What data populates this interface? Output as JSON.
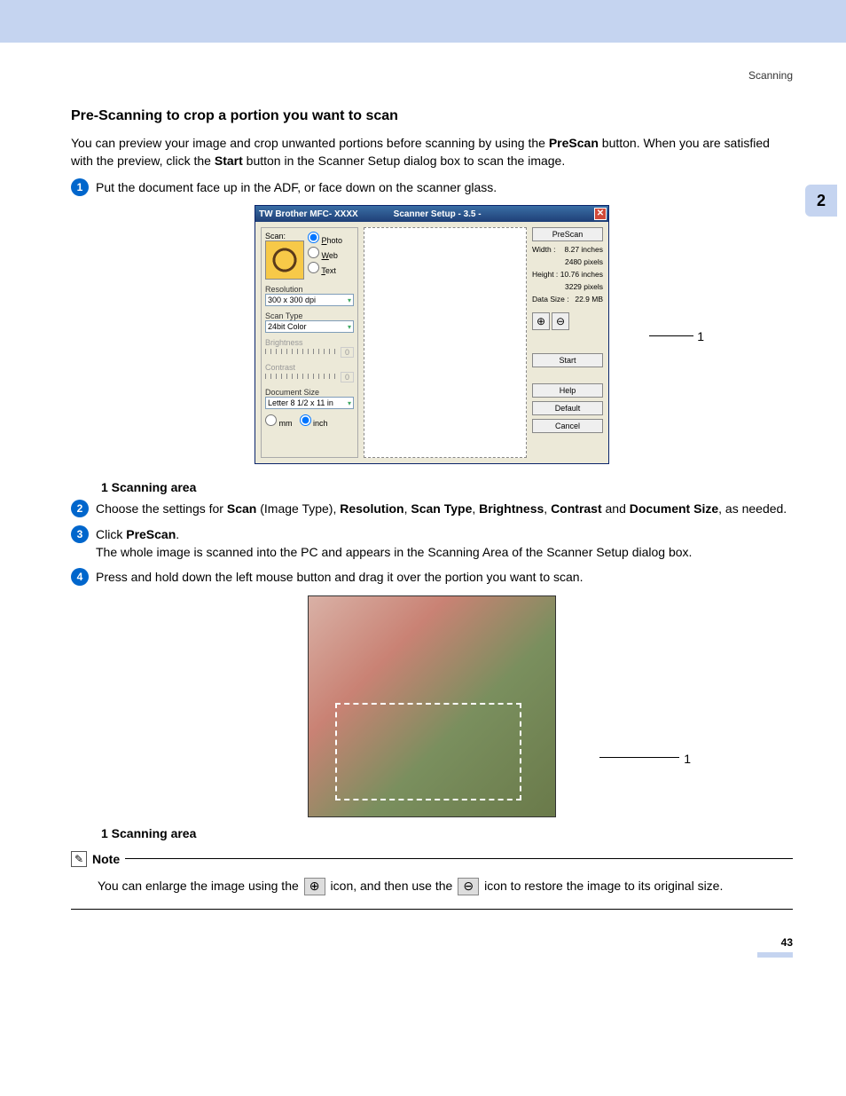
{
  "header_label": "Scanning",
  "side_tab": "2",
  "section_title": "Pre-Scanning to crop a portion you want to scan",
  "intro": {
    "line1_pre": "You can preview your image and crop unwanted portions before scanning by using the ",
    "line1_bold": "PreScan",
    "line1_post": " button.",
    "line2_pre": "When you are satisfied with the preview, click the ",
    "line2_bold": "Start",
    "line2_post": " button in the Scanner Setup dialog box to scan the image."
  },
  "steps": {
    "s1": "Put the document face up in the ADF, or face down on the scanner glass.",
    "s2_pre": "Choose the settings for ",
    "s2_b1": "Scan",
    "s2_mid1": " (Image Type), ",
    "s2_b2": "Resolution",
    "s2_mid2": ", ",
    "s2_b3": "Scan Type",
    "s2_mid3": ", ",
    "s2_b4": "Brightness",
    "s2_mid4": ", ",
    "s2_b5": "Contrast",
    "s2_mid5": " and ",
    "s2_b6": "Document Size",
    "s2_post": ", as needed.",
    "s3_pre": "Click ",
    "s3_b": "PreScan",
    "s3_post": ".",
    "s3_line2": "The whole image is scanned into the PC and appears in the Scanning Area of the Scanner Setup dialog box.",
    "s4": "Press and hold down the left mouse button and drag it over the portion you want to scan."
  },
  "caption1": "1   Scanning area",
  "caption2": "1   Scanning area",
  "callout1": "1",
  "callout2": "1",
  "dialog": {
    "title_left": "TW Brother MFC- XXXX",
    "title_mid": "Scanner Setup - 3.5 -",
    "scan_label": "Scan:",
    "radio_photo": "Photo",
    "radio_web": "Web",
    "radio_text": "Text",
    "resolution_label": "Resolution",
    "resolution_value": "300 x 300 dpi",
    "scantype_label": "Scan Type",
    "scantype_value": "24bit Color",
    "brightness_label": "Brightness",
    "brightness_value": "0",
    "contrast_label": "Contrast",
    "contrast_value": "0",
    "docsize_label": "Document Size",
    "docsize_value": "Letter 8 1/2 x 11 in",
    "unit_mm": "mm",
    "unit_inch": "inch",
    "prescan_btn": "PreScan",
    "width_label": "Width :",
    "width_in": "8.27 inches",
    "width_px": "2480 pixels",
    "height_label": "Height :",
    "height_in": "10.76 inches",
    "height_px": "3229 pixels",
    "datasize_label": "Data Size :",
    "datasize_val": "22.9 MB",
    "start_btn": "Start",
    "help_btn": "Help",
    "default_btn": "Default",
    "cancel_btn": "Cancel"
  },
  "note": {
    "label": "Note",
    "pre": "You can enlarge the image using the ",
    "mid": " icon, and then use the ",
    "post": " icon to restore the image to its original size."
  },
  "page_number": "43"
}
